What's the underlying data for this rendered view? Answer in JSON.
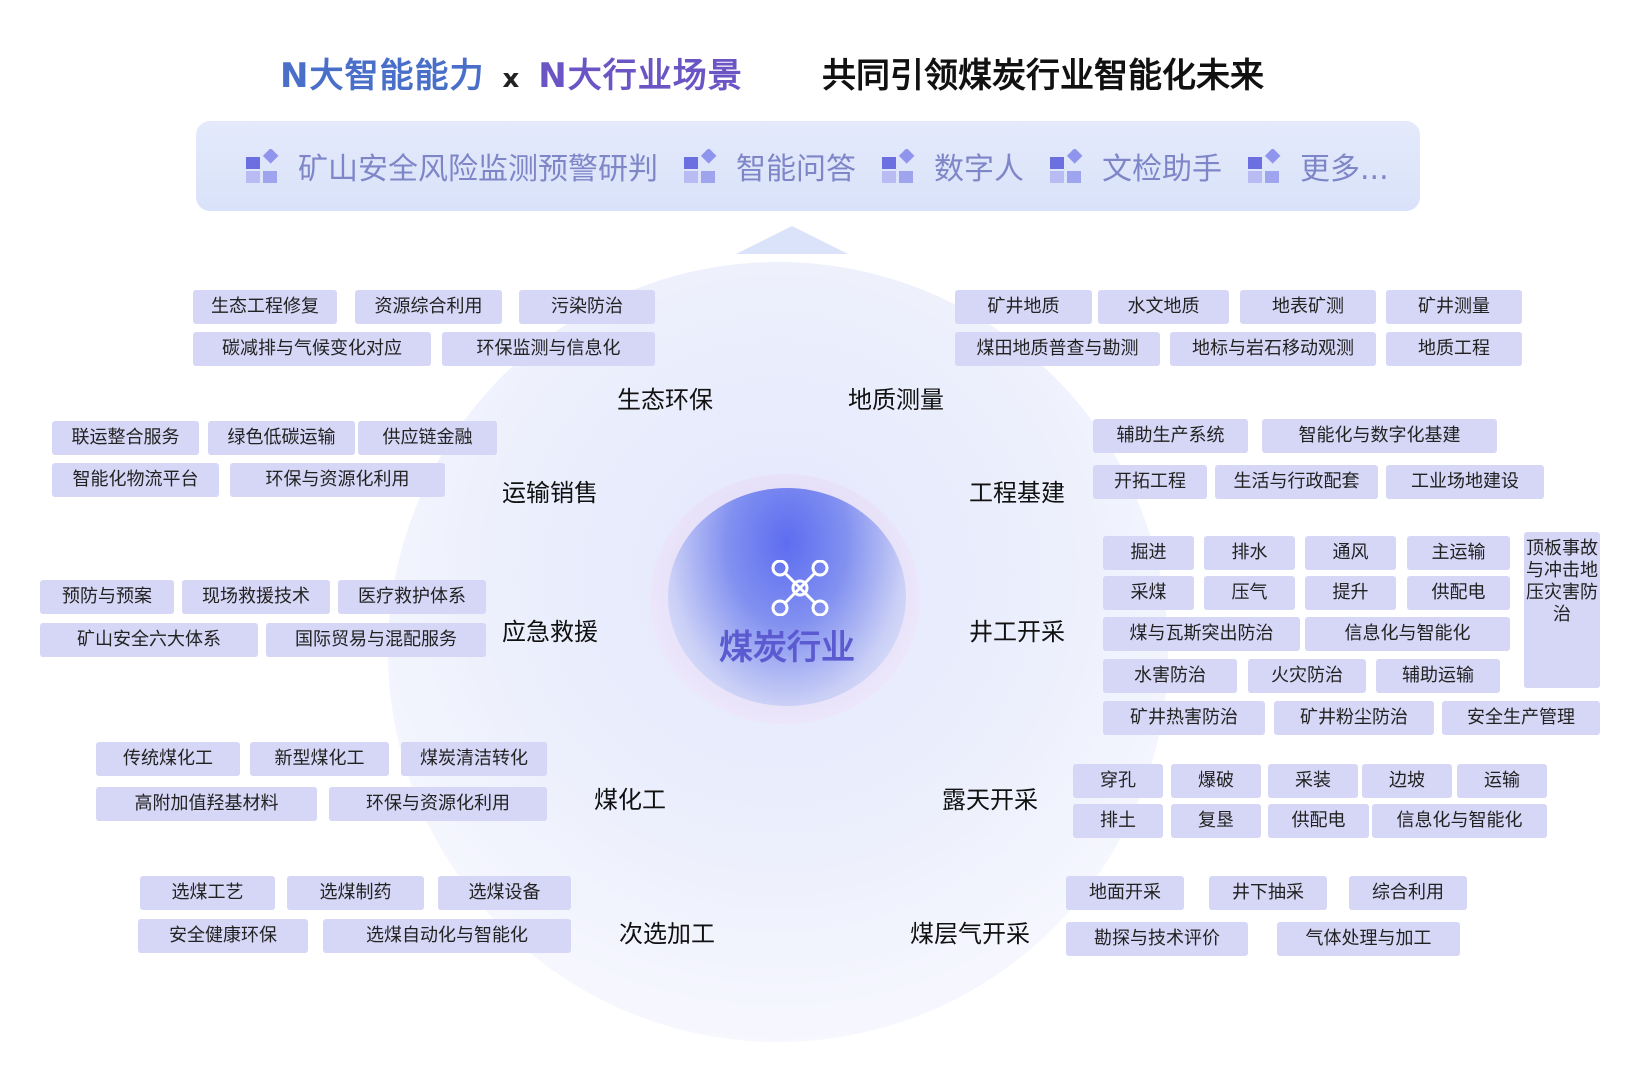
{
  "header": {
    "left_part1": "N大智能能力",
    "x": "x",
    "left_part2": "N大行业场景",
    "right": "共同引领煤炭行业智能化未来"
  },
  "banner": {
    "items": [
      "矿山安全风险监测预警研判",
      "智能问答",
      "数字人",
      "文检助手",
      "更多..."
    ]
  },
  "center": {
    "label": "煤炭行业"
  },
  "categories": {
    "ecology": "生态环保",
    "geology": "地质测量",
    "transport": "运输销售",
    "construction": "工程基建",
    "rescue": "应急救援",
    "underground": "井工开采",
    "chemical": "煤化工",
    "openpit": "露天开采",
    "processing": "次选加工",
    "cbm": "煤层气开采"
  },
  "tags": {
    "ecology": [
      "生态工程修复",
      "资源综合利用",
      "污染防治",
      "碳减排与气候变化对应",
      "环保监测与信息化"
    ],
    "geology": [
      "矿井地质",
      "水文地质",
      "地表矿测",
      "矿井测量",
      "煤田地质普查与勘测",
      "地标与岩石移动观测",
      "地质工程"
    ],
    "transport": [
      "联运整合服务",
      "绿色低碳运输",
      "供应链金融",
      "智能化物流平台",
      "环保与资源化利用"
    ],
    "construction": [
      "辅助生产系统",
      "智能化与数字化基建",
      "开拓工程",
      "生活与行政配套",
      "工业场地建设"
    ],
    "rescue": [
      "预防与预案",
      "现场救援技术",
      "医疗救护体系",
      "矿山安全六大体系",
      "国际贸易与混配服务"
    ],
    "underground": [
      "掘进",
      "排水",
      "通风",
      "主运输",
      "采煤",
      "压气",
      "提升",
      "供配电",
      "煤与瓦斯突出防治",
      "信息化与智能化",
      "水害防治",
      "火灾防治",
      "辅助运输",
      "矿井热害防治",
      "矿井粉尘防治",
      "安全生产管理",
      "顶板事故与冲击地压灾害防治"
    ],
    "chemical": [
      "传统煤化工",
      "新型煤化工",
      "煤炭清洁转化",
      "高附加值羟基材料",
      "环保与资源化利用"
    ],
    "openpit": [
      "穿孔",
      "爆破",
      "采装",
      "边坡",
      "运输",
      "排土",
      "复垦",
      "供配电",
      "信息化与智能化"
    ],
    "processing": [
      "选煤工艺",
      "选煤制药",
      "选煤设备",
      "安全健康环保",
      "选煤自动化与智能化"
    ],
    "cbm": [
      "地面开采",
      "井下抽采",
      "综合利用",
      "勘探与技术评价",
      "气体处理与加工"
    ]
  }
}
